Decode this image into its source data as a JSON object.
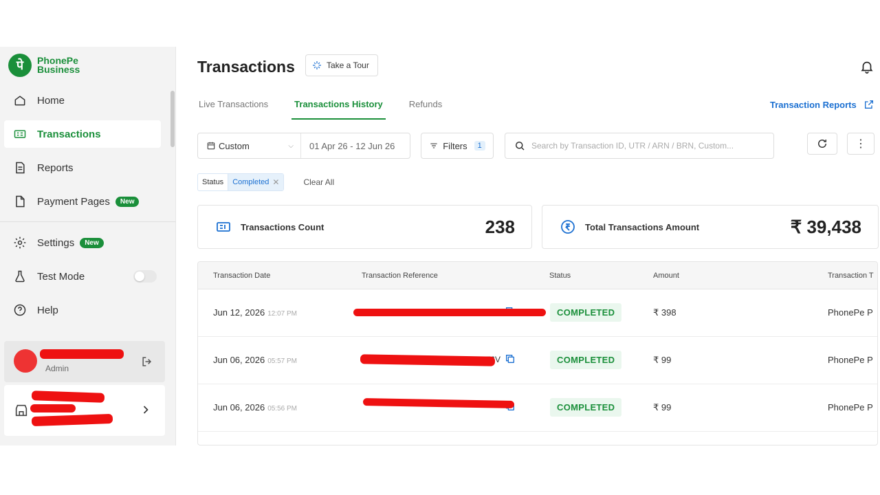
{
  "brand": {
    "name_line1": "PhonePe",
    "name_line2": "Business",
    "mark": "पे"
  },
  "sidebar": {
    "items": [
      {
        "label": "Home",
        "icon": "home-icon"
      },
      {
        "label": "Transactions",
        "icon": "transactions-icon",
        "active": true
      },
      {
        "label": "Reports",
        "icon": "reports-icon"
      },
      {
        "label": "Payment Pages",
        "icon": "payment-pages-icon",
        "badge": "New"
      }
    ],
    "secondary": [
      {
        "label": "Settings",
        "icon": "gear-icon",
        "badge": "New"
      },
      {
        "label": "Test Mode",
        "icon": "flask-icon"
      },
      {
        "label": "Help",
        "icon": "help-icon"
      }
    ],
    "user_role": "Admin"
  },
  "header": {
    "title": "Transactions",
    "tour_label": "Take a Tour"
  },
  "tabs": [
    {
      "label": "Live Transactions"
    },
    {
      "label": "Transactions History",
      "active": true
    },
    {
      "label": "Refunds"
    }
  ],
  "reports_link": "Transaction Reports",
  "filters": {
    "date_mode": "Custom",
    "date_range": "01 Apr 26 - 12 Jun 26",
    "filters_label": "Filters",
    "filters_count": "1",
    "search_placeholder": "Search by Transaction ID, UTR / ARN / BRN, Custom..."
  },
  "chips": {
    "status_key": "Status",
    "status_value": "Completed",
    "clear_all": "Clear All"
  },
  "stats": {
    "count_label": "Transactions Count",
    "count_value": "238",
    "amount_label": "Total Transactions Amount",
    "amount_value": "₹ 39,438"
  },
  "table": {
    "headers": [
      "Transaction Date",
      "Transaction Reference",
      "Status",
      "Amount",
      "Transaction T"
    ],
    "rows": [
      {
        "date": "Jun 12, 2026",
        "time": "12:07 PM",
        "ref": "",
        "status": "COMPLETED",
        "amount": "₹ 398",
        "type": "PhonePe P"
      },
      {
        "date": "Jun 06, 2026",
        "time": "05:57 PM",
        "ref": "...H87076V",
        "status": "COMPLETED",
        "amount": "₹ 99",
        "type": "PhonePe P"
      },
      {
        "date": "Jun 06, 2026",
        "time": "05:56 PM",
        "ref": "",
        "status": "COMPLETED",
        "amount": "₹ 99",
        "type": "PhonePe P"
      }
    ]
  },
  "colors": {
    "brand_green": "#1a8f3a",
    "link_blue": "#1a6fd1",
    "redaction": "#e11111"
  }
}
